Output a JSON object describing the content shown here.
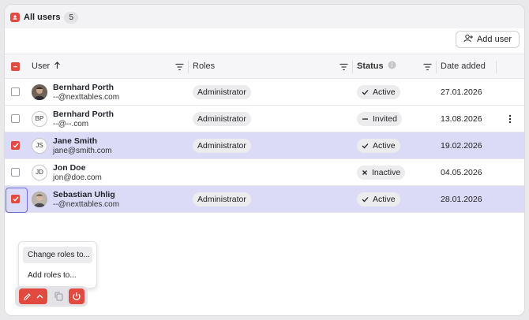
{
  "tab": {
    "label": "All users",
    "count": "5"
  },
  "toolbar": {
    "add_user_label": "Add user"
  },
  "columns": {
    "user": "User",
    "roles": "Roles",
    "status": "Status",
    "date": "Date added"
  },
  "rows": [
    {
      "initials": "",
      "name": "Bernhard Porth",
      "email": "--@nexttables.com",
      "role": "Administrator",
      "status": "Active",
      "date": "27.01.2026",
      "selected": false
    },
    {
      "initials": "BP",
      "name": "Bernhard Porth",
      "email": "--@--.com",
      "role": "Administrator",
      "status": "Invited",
      "date": "13.08.2026",
      "selected": false
    },
    {
      "initials": "JS",
      "name": "Jane Smith",
      "email": "jane@smith.com",
      "role": "Administrator",
      "status": "Active",
      "date": "19.02.2026",
      "selected": true
    },
    {
      "initials": "JD",
      "name": "Jon Doe",
      "email": "jon@doe.com",
      "role": "",
      "status": "Inactive",
      "date": "04.05.2026",
      "selected": false
    },
    {
      "initials": "",
      "name": "Sebastian Uhlig",
      "email": "--@nexttables.com",
      "role": "Administrator",
      "status": "Active",
      "date": "28.01.2026",
      "selected": true
    }
  ],
  "popup": {
    "change_roles": "Change roles to...",
    "add_roles": "Add roles to..."
  },
  "colors": {
    "accent": "#e24a40",
    "selected_row": "#dcdbf7"
  }
}
